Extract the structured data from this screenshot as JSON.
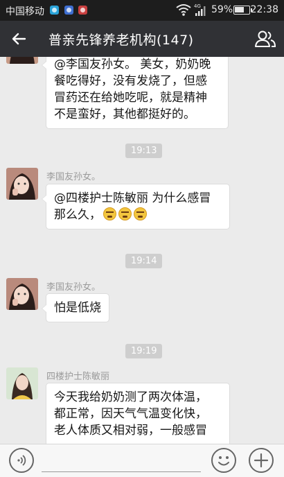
{
  "status_bar": {
    "carrier": "中国移动",
    "network": "4G",
    "battery": "59%",
    "time": "22:38"
  },
  "header": {
    "title": "普亲先锋养老机构(147)",
    "back_icon": "arrow-left-icon",
    "group_icon": "group-members-icon"
  },
  "messages": [
    {
      "sender": "",
      "lines": [
        "@李国友孙女。 美女，奶奶晚",
        "餐吃得好，没有发烧了，但感",
        "冒药还在给她吃呢，就是精神",
        "不是蛮好，其他都挺好的。"
      ]
    },
    {
      "time": "19:13",
      "sender": "李国友孙女。",
      "lines": [
        "@四楼护士陈敏丽 为什么感冒",
        "那么久，"
      ],
      "emoji_count": 3
    },
    {
      "time": "19:14",
      "sender": "李国友孙女。",
      "lines": [
        "怕是低烧"
      ]
    },
    {
      "time": "19:19",
      "sender": "四楼护士陈敏丽",
      "lines": [
        "今天我给奶奶测了两次体温，",
        "都正常，因天气气温变化快，",
        "老人体质又相对弱，一般感冒"
      ]
    }
  ],
  "input_bar": {
    "placeholder": "",
    "icons": [
      "voice-icon",
      "emoji-icon",
      "plus-icon"
    ]
  },
  "colors": {
    "header_bg": "#303135",
    "chat_bg": "#ebebeb",
    "time_badge_bg": "#cecece"
  }
}
